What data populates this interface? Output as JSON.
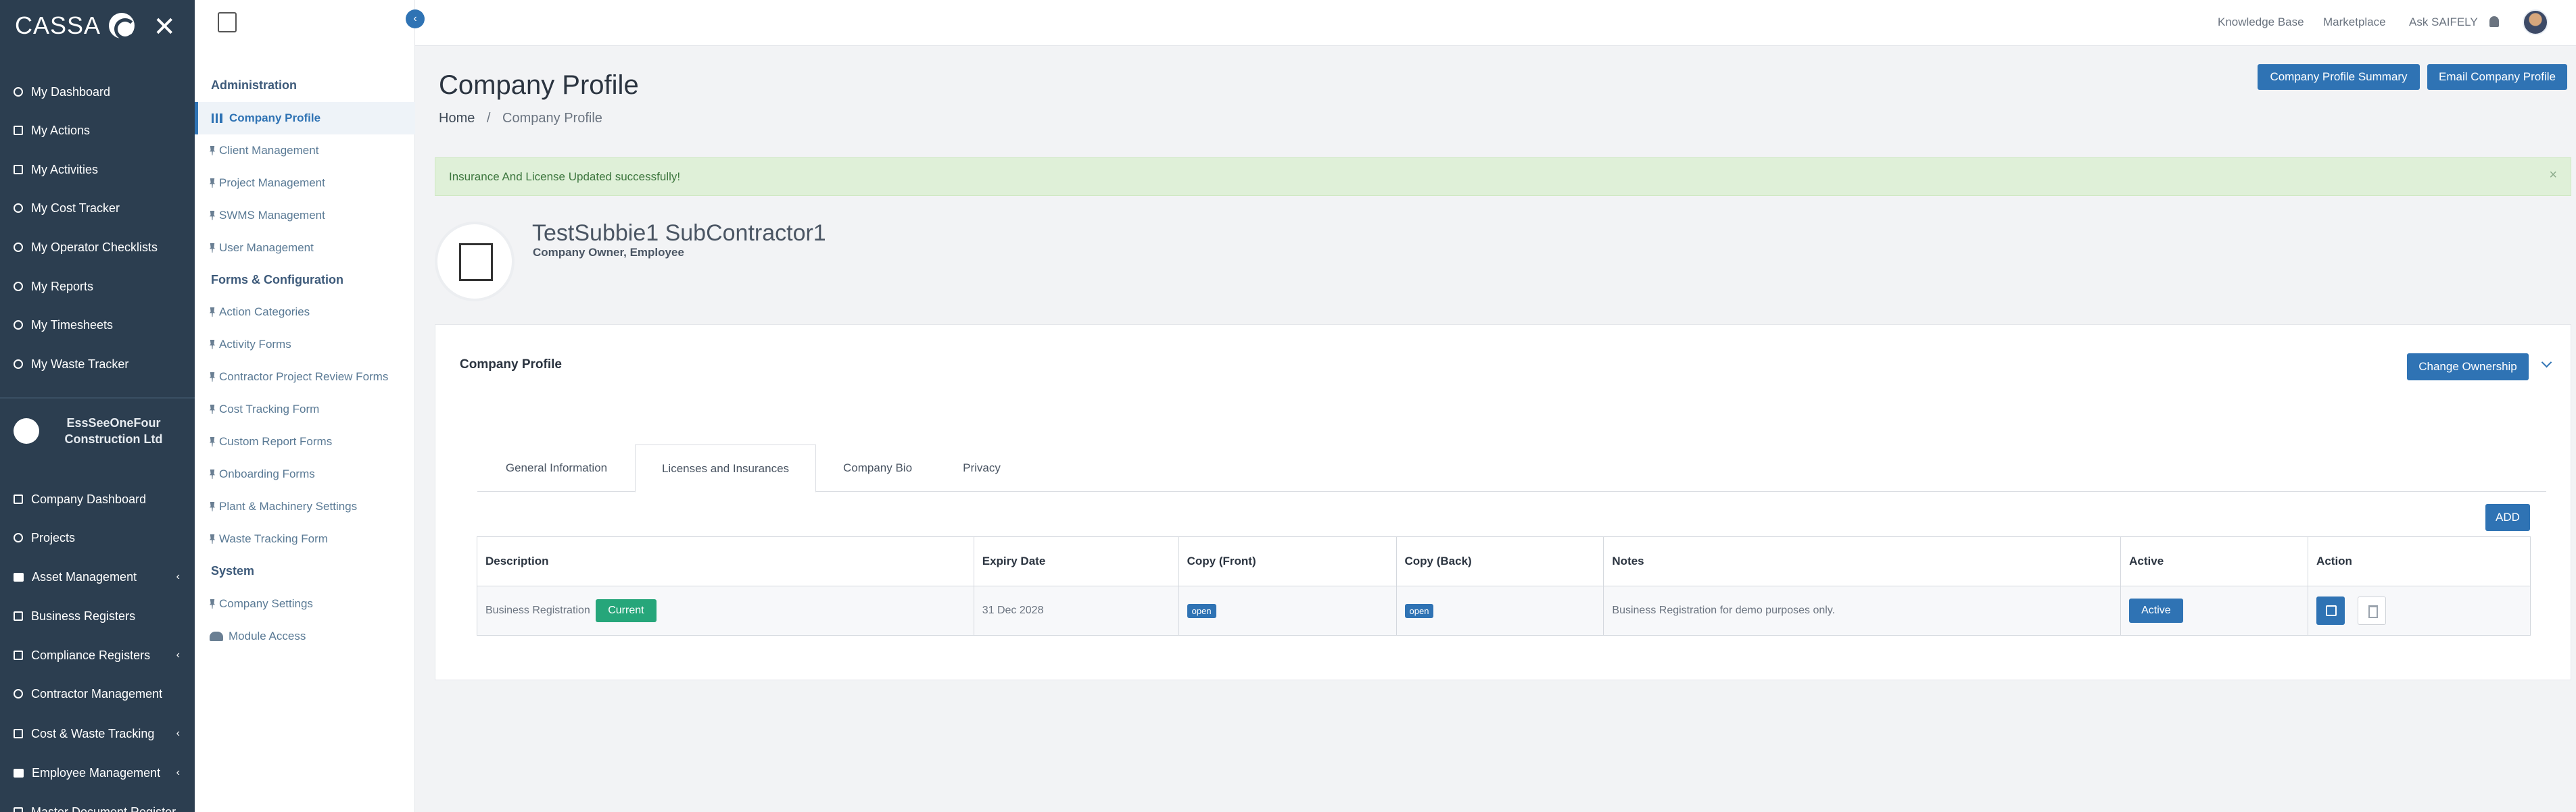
{
  "brand": {
    "name": "CASSA"
  },
  "sidebar": {
    "items": [
      {
        "label": "My Dashboard",
        "icon": "gauge-icon"
      },
      {
        "label": "My Actions",
        "icon": "box-icon"
      },
      {
        "label": "My Activities",
        "icon": "box-icon"
      },
      {
        "label": "My Cost Tracker",
        "icon": "ring-icon"
      },
      {
        "label": "My Operator Checklists",
        "icon": "ring-icon"
      },
      {
        "label": "My Reports",
        "icon": "ring-icon"
      },
      {
        "label": "My Timesheets",
        "icon": "user-icon"
      },
      {
        "label": "My Waste Tracker",
        "icon": "user-icon"
      }
    ],
    "company_name": "EssSeeOneFour Construction Ltd",
    "company_items": [
      {
        "label": "Company Dashboard",
        "chevron": false
      },
      {
        "label": "Projects",
        "chevron": false
      },
      {
        "label": "Asset Management",
        "chevron": true
      },
      {
        "label": "Business Registers",
        "chevron": false
      },
      {
        "label": "Compliance Registers",
        "chevron": true
      },
      {
        "label": "Contractor Management",
        "chevron": false
      },
      {
        "label": "Cost & Waste Tracking",
        "chevron": true
      },
      {
        "label": "Employee Management",
        "chevron": true
      },
      {
        "label": "Master Document Register",
        "chevron": false
      }
    ]
  },
  "subnav": {
    "heading_admin": "Administration",
    "admin_items": [
      "Company Profile",
      "Client Management",
      "Project Management",
      "SWMS Management",
      "User Management"
    ],
    "heading_forms": "Forms & Configuration",
    "forms_items": [
      "Action Categories",
      "Activity Forms",
      "Contractor Project Review Forms",
      "Cost Tracking Form",
      "Custom Report Forms",
      "Onboarding Forms",
      "Plant & Machinery Settings",
      "Waste Tracking Form"
    ],
    "heading_system": "System",
    "system_items": [
      "Company Settings",
      "Module Access"
    ]
  },
  "topbar": {
    "links": [
      "Knowledge Base",
      "Marketplace",
      "Ask SAIFELY"
    ]
  },
  "header": {
    "title": "Company Profile",
    "breadcrumb_home": "Home",
    "breadcrumb_sep": "/",
    "breadcrumb_current": "Company Profile",
    "summary_button": "Company Profile Summary",
    "email_button": "Email Company Profile"
  },
  "alert": {
    "message": "Insurance And License Updated successfully!",
    "close": "×"
  },
  "profile": {
    "name": "TestSubbie1 SubContractor1",
    "roles": "Company Owner, Employee"
  },
  "panel": {
    "title": "Company Profile",
    "change_ownership": "Change Ownership",
    "tabs": [
      "General Information",
      "Licenses and Insurances",
      "Company Bio",
      "Privacy"
    ],
    "active_tab": 1,
    "add_button": "ADD",
    "columns": [
      "Description",
      "Expiry Date",
      "Copy (Front)",
      "Copy (Back)",
      "Notes",
      "Active",
      "Action"
    ],
    "rows": [
      {
        "description": "Business Registration",
        "status": "Current",
        "expiry": "31 Dec 2028",
        "front": "open",
        "back": "open",
        "notes": "Business Registration for demo purposes only.",
        "active": "Active"
      }
    ]
  },
  "colors": {
    "sidebar": "#2c3e50",
    "primary": "#2f73b4",
    "success_bg": "#dff0d8",
    "current_badge": "#26a67a"
  }
}
